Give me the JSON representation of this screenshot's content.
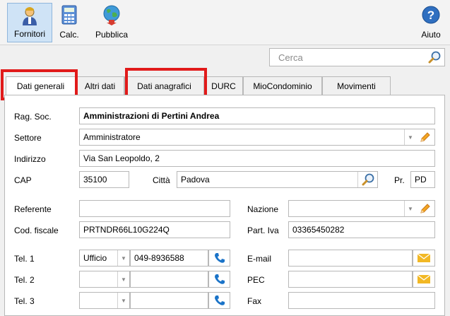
{
  "toolbar": {
    "buttons": [
      {
        "label": "Fornitori",
        "icon": "user-icon"
      },
      {
        "label": "Calc.",
        "icon": "calculator-icon"
      },
      {
        "label": "Pubblica",
        "icon": "globe-icon"
      }
    ],
    "help": {
      "label": "Aiuto",
      "icon": "help-icon"
    }
  },
  "search": {
    "placeholder": "Cerca"
  },
  "tabs": [
    "Dati generali",
    "Altri dati",
    "Dati anagrafici",
    "DURC",
    "MioCondominio",
    "Movimenti"
  ],
  "form": {
    "rag_soc": {
      "label": "Rag. Soc.",
      "value": "Amministrazioni di Pertini Andrea"
    },
    "settore": {
      "label": "Settore",
      "value": "Amministratore"
    },
    "indirizzo": {
      "label": "Indirizzo",
      "value": "Via San Leopoldo, 2"
    },
    "cap": {
      "label": "CAP",
      "value": "35100"
    },
    "citta": {
      "label": "Città",
      "value": "Padova"
    },
    "pr": {
      "label": "Pr.",
      "value": "PD"
    },
    "referente": {
      "label": "Referente",
      "value": ""
    },
    "nazione": {
      "label": "Nazione",
      "value": ""
    },
    "cod_fiscale": {
      "label": "Cod. fiscale",
      "value": "PRTNDR66L10G224Q"
    },
    "part_iva": {
      "label": "Part. Iva",
      "value": "03365450282"
    },
    "tel1": {
      "label": "Tel. 1",
      "type": "Ufficio",
      "value": "049-8936588"
    },
    "tel2": {
      "label": "Tel. 2",
      "type": "",
      "value": ""
    },
    "tel3": {
      "label": "Tel. 3",
      "type": "",
      "value": ""
    },
    "email": {
      "label": "E-mail",
      "value": ""
    },
    "pec": {
      "label": "PEC",
      "value": ""
    },
    "fax": {
      "label": "Fax",
      "value": ""
    }
  },
  "colors": {
    "accent_red": "#e11a1a",
    "phone_blue": "#1a73c8",
    "mail_yellow": "#f2b824"
  }
}
